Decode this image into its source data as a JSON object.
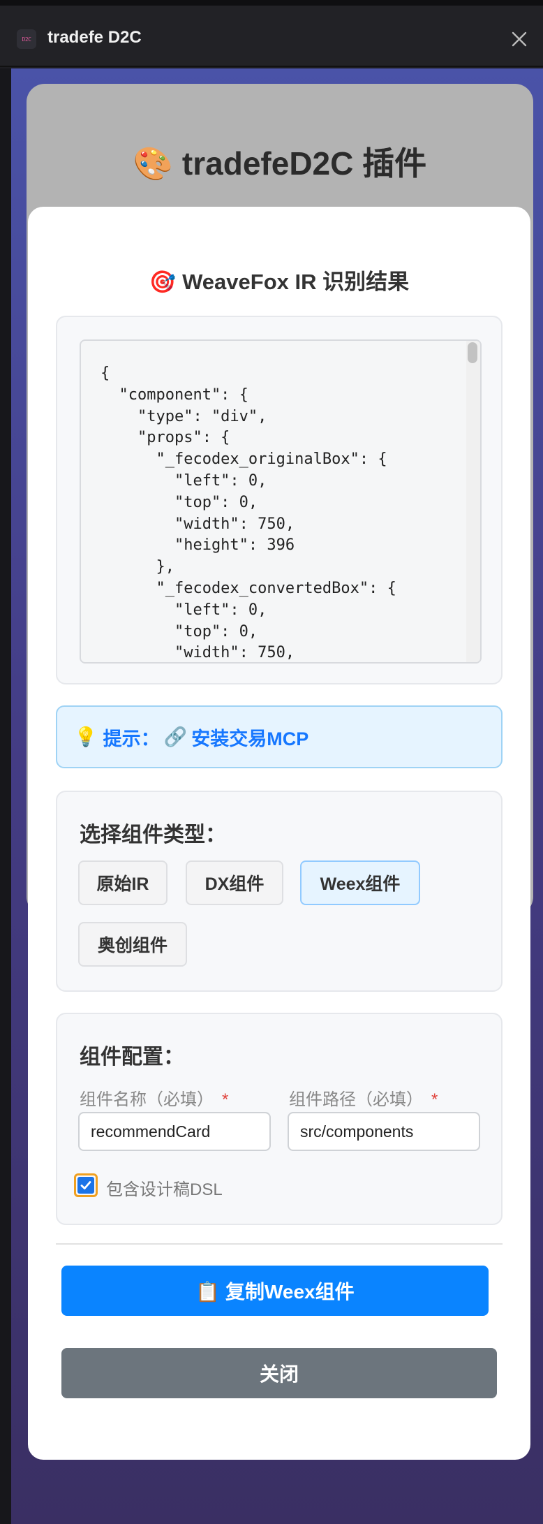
{
  "window": {
    "title": "tradefe D2C",
    "app_icon_text": "D2C"
  },
  "background_card": {
    "title": "🎨 tradefeD2C 插件"
  },
  "modal": {
    "title": "🎯 WeaveFox IR 识别结果",
    "ir_code": "{\n  \"component\": {\n    \"type\": \"div\",\n    \"props\": {\n      \"_fecodex_originalBox\": {\n        \"left\": 0,\n        \"top\": 0,\n        \"width\": 750,\n        \"height\": 396\n      },\n      \"_fecodex_convertedBox\": {\n        \"left\": 0,\n        \"top\": 0,\n        \"width\": 750,",
    "tip": {
      "prefix": "提示：",
      "link_label": "安装交易MCP"
    },
    "component_type": {
      "title": "选择组件类型：",
      "options": [
        "原始IR",
        "DX组件",
        "Weex组件",
        "奥创组件"
      ],
      "selected": "Weex组件"
    },
    "config": {
      "title": "组件配置：",
      "name_label": "组件名称（必填）",
      "name_value": "recommendCard",
      "path_label": "组件路径（必填）",
      "path_value": "src/components",
      "required_mark": "*",
      "include_dsl_label": "包含设计稿DSL",
      "include_dsl_checked": true
    },
    "copy_button": "📋 复制Weex组件",
    "close_button": "关闭"
  },
  "colors": {
    "primary": "#0a84ff",
    "secondary": "#6c757d",
    "tip_text": "#1677ff",
    "required": "#e0413a"
  }
}
